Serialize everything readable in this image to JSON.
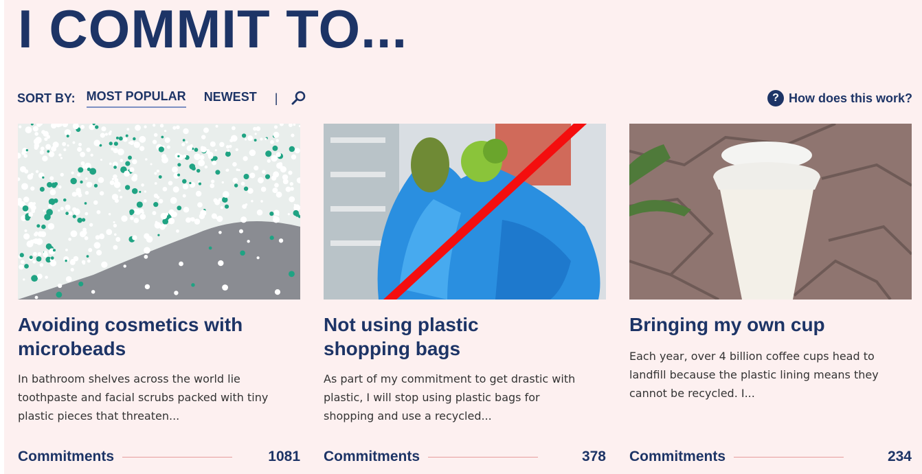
{
  "page": {
    "title": "I COMMIT TO..."
  },
  "sort": {
    "label": "SORT BY:",
    "options": [
      "MOST POPULAR",
      "NEWEST"
    ],
    "separator": "|",
    "search_icon": "search-icon"
  },
  "help": {
    "icon": "question-icon",
    "icon_glyph": "?",
    "label": "How does this work?"
  },
  "cards": [
    {
      "title_line1": "Avoiding cosmetics with",
      "title_line2": "microbeads",
      "desc": "In bathroom shelves across the world lie toothpaste and facial scrubs packed with tiny plastic pieces that threaten...",
      "footer_label": "Commitments",
      "count": "1081"
    },
    {
      "title_line1": "Not using plastic",
      "title_line2": "shopping bags",
      "desc": "As part of my commitment to get drastic with plastic, I will stop using plastic bags for shopping and use a recycled...",
      "footer_label": "Commitments",
      "count": "378"
    },
    {
      "title_line1": "Bringing my own cup",
      "title_line2": "",
      "desc": "Each year, over 4 billion coffee cups head to landfill because the plastic lining means they cannot be recycled. I...",
      "footer_label": "Commitments",
      "count": "234"
    }
  ],
  "colors": {
    "navy": "#1d3466",
    "background": "#fdf0f0",
    "divider": "#e69a9a"
  }
}
